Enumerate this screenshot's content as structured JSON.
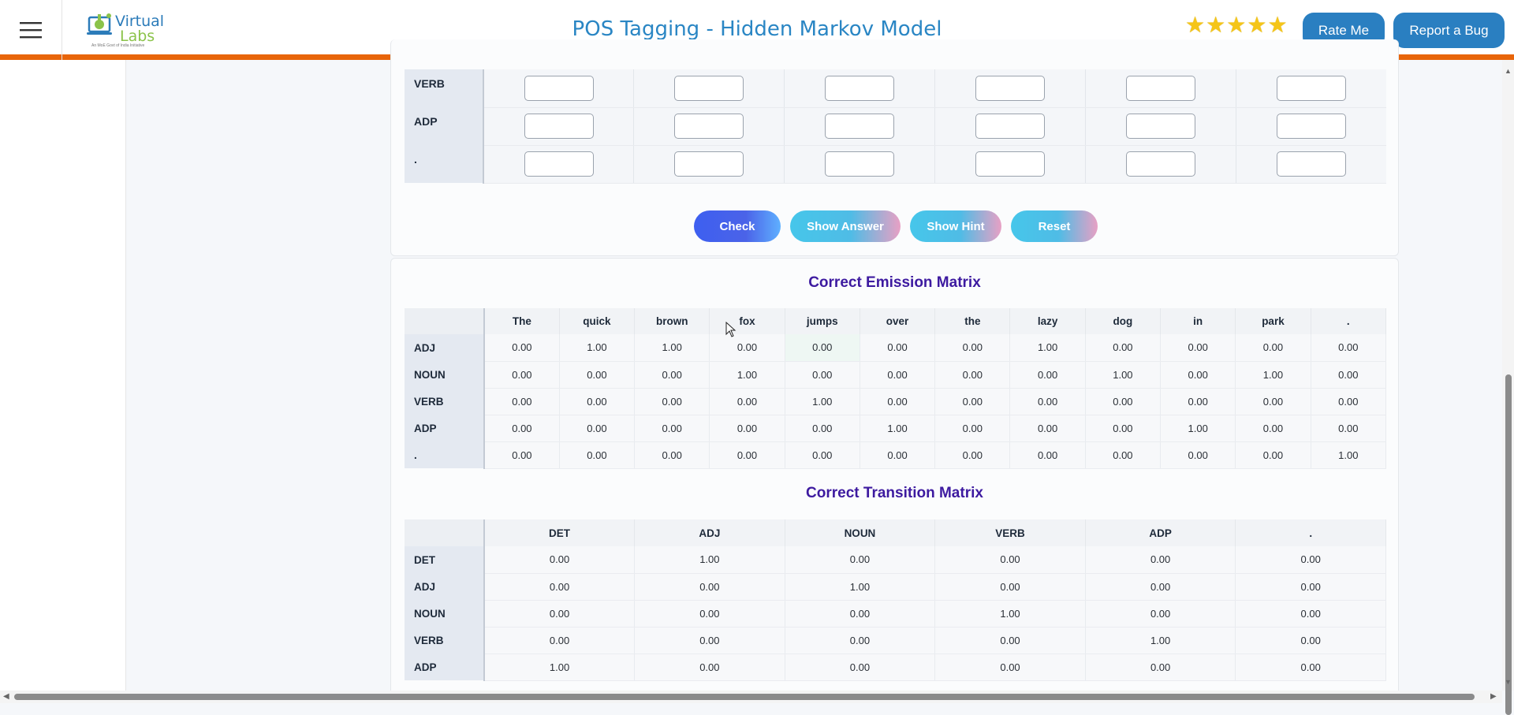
{
  "header": {
    "logo": {
      "line1": "Virtual",
      "line2": "Labs",
      "tagline": "An MoE Govt of India Initiative"
    },
    "title": "POS Tagging - Hidden Markov Model",
    "rating": 5,
    "rate_label": "Rate Me",
    "bug_label": "Report a Bug",
    "accent_color": "#e8650a",
    "button_color": "#2a7fc1"
  },
  "input_matrix": {
    "rows": [
      "VERB",
      "ADP",
      "."
    ],
    "columns_count": 6
  },
  "actions": {
    "check": "Check",
    "show_answer": "Show Answer",
    "show_hint": "Show Hint",
    "reset": "Reset"
  },
  "emission": {
    "title": "Correct Emission Matrix",
    "columns": [
      "The",
      "quick",
      "brown",
      "fox",
      "jumps",
      "over",
      "the",
      "lazy",
      "dog",
      "in",
      "park",
      "."
    ],
    "rows": [
      {
        "tag": "ADJ",
        "values": [
          "0.00",
          "1.00",
          "1.00",
          "0.00",
          "0.00",
          "0.00",
          "0.00",
          "1.00",
          "0.00",
          "0.00",
          "0.00",
          "0.00"
        ]
      },
      {
        "tag": "NOUN",
        "values": [
          "0.00",
          "0.00",
          "0.00",
          "1.00",
          "0.00",
          "0.00",
          "0.00",
          "0.00",
          "1.00",
          "0.00",
          "1.00",
          "0.00"
        ]
      },
      {
        "tag": "VERB",
        "values": [
          "0.00",
          "0.00",
          "0.00",
          "0.00",
          "1.00",
          "0.00",
          "0.00",
          "0.00",
          "0.00",
          "0.00",
          "0.00",
          "0.00"
        ]
      },
      {
        "tag": "ADP",
        "values": [
          "0.00",
          "0.00",
          "0.00",
          "0.00",
          "0.00",
          "1.00",
          "0.00",
          "0.00",
          "0.00",
          "1.00",
          "0.00",
          "0.00"
        ]
      },
      {
        "tag": ".",
        "values": [
          "0.00",
          "0.00",
          "0.00",
          "0.00",
          "0.00",
          "0.00",
          "0.00",
          "0.00",
          "0.00",
          "0.00",
          "0.00",
          "1.00"
        ]
      }
    ]
  },
  "transition": {
    "title": "Correct Transition Matrix",
    "columns": [
      "DET",
      "ADJ",
      "NOUN",
      "VERB",
      "ADP",
      "."
    ],
    "rows": [
      {
        "tag": "DET",
        "values": [
          "0.00",
          "1.00",
          "0.00",
          "0.00",
          "0.00",
          "0.00"
        ]
      },
      {
        "tag": "ADJ",
        "values": [
          "0.00",
          "0.00",
          "1.00",
          "0.00",
          "0.00",
          "0.00"
        ]
      },
      {
        "tag": "NOUN",
        "values": [
          "0.00",
          "0.00",
          "0.00",
          "1.00",
          "0.00",
          "0.00"
        ]
      },
      {
        "tag": "VERB",
        "values": [
          "0.00",
          "0.00",
          "0.00",
          "0.00",
          "1.00",
          "0.00"
        ]
      },
      {
        "tag": "ADP",
        "values": [
          "1.00",
          "0.00",
          "0.00",
          "0.00",
          "0.00",
          "0.00"
        ]
      }
    ]
  }
}
